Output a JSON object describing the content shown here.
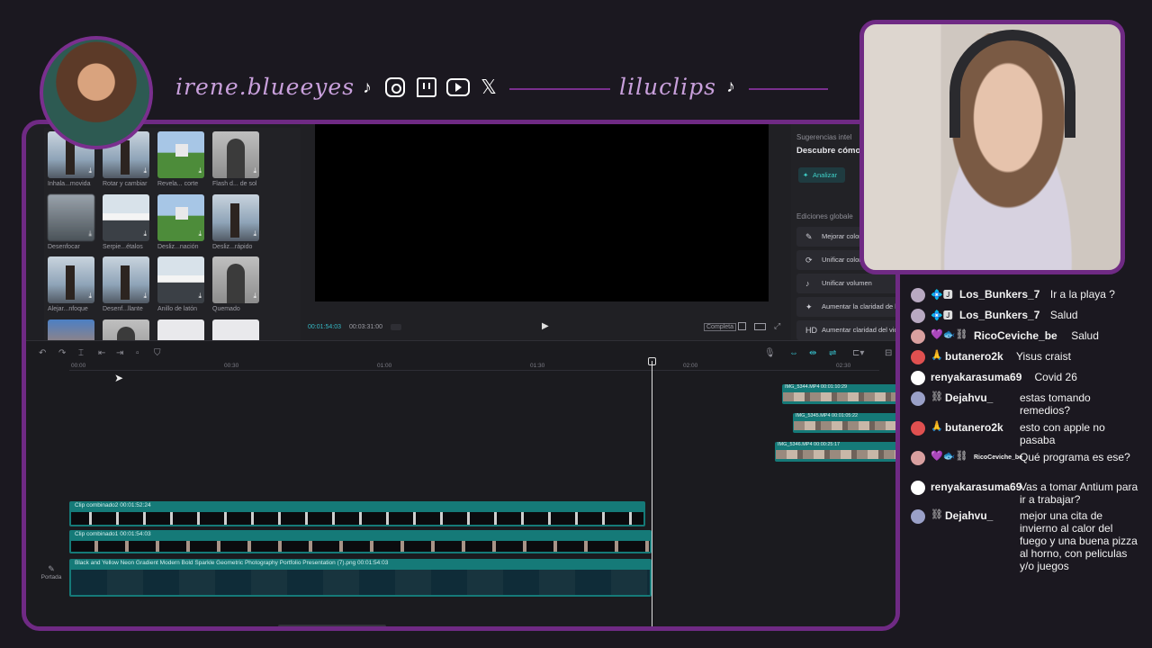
{
  "header": {
    "handle": "irene.blueeyes",
    "second_handle": "liluclips",
    "social_icons": [
      "tiktok-icon",
      "instagram-icon",
      "twitch-icon",
      "youtube-icon",
      "x-icon"
    ],
    "accent_color": "#6f2a84"
  },
  "effects": {
    "items": [
      {
        "label": "Inhala...movida",
        "thumb": "tower"
      },
      {
        "label": "Rotar y cambiar",
        "thumb": "tower"
      },
      {
        "label": "Revela... corte",
        "thumb": "field"
      },
      {
        "label": "Flash d... de sol",
        "thumb": "person"
      },
      {
        "label": "Desenfocar",
        "thumb": "blur"
      },
      {
        "label": "Serpie...étalos",
        "thumb": "mount"
      },
      {
        "label": "Desliz...nación",
        "thumb": "field"
      },
      {
        "label": "Desliz...rápido",
        "thumb": "tower"
      },
      {
        "label": "Alejar...nfoque",
        "thumb": "tower"
      },
      {
        "label": "Desenf...llante",
        "thumb": "tower"
      },
      {
        "label": "Anillo de latón",
        "thumb": "mount"
      },
      {
        "label": "Quemado",
        "thumb": "person"
      },
      {
        "label": "",
        "thumb": "orange"
      },
      {
        "label": "",
        "thumb": "person"
      },
      {
        "label": "",
        "thumb": "white"
      },
      {
        "label": "",
        "thumb": "white"
      }
    ]
  },
  "preview": {
    "current_time": "00:01:54:03",
    "total_time": "00:03:31:00",
    "complete_label": "Completa"
  },
  "side_panel": {
    "heading": "Sugerencias intel",
    "subheading": "Descubre cómo",
    "analyze_label": "Analizar",
    "global_heading": "Ediciones globale",
    "buttons": [
      {
        "icon": "palette-icon",
        "glyph": "✎",
        "label": "Mejorar color"
      },
      {
        "icon": "sync-icon",
        "glyph": "⟳",
        "label": "Unificar colore"
      },
      {
        "icon": "volume-icon",
        "glyph": "♪",
        "label": "Unificar volumen"
      },
      {
        "icon": "sparkle-icon",
        "glyph": "✦",
        "label": "Aumentar la claridad de la"
      },
      {
        "icon": "hd-icon",
        "glyph": "HD",
        "label": "Aumentar claridad del vide"
      }
    ]
  },
  "timeline": {
    "ruler": [
      "00:00",
      "00:30",
      "01:00",
      "01:30",
      "02:00",
      "02:30"
    ],
    "tracks": [
      {
        "label": "Clip combinado2  00:01:52:24"
      },
      {
        "label": "Clip combinado1  00:01:54:03"
      },
      {
        "label": "Black and Yellow Neon Gradient Modern Bold Sparkle Geometric Photography Portfolio Presentation (7).png  00:01:54:03"
      }
    ],
    "right_clips": [
      {
        "label": "IMG_5344.MP4  00:01:10:29"
      },
      {
        "label": "IMG_5345.MP4  00:01:05:22"
      },
      {
        "label": "IMG_5346.MP4  00:00:25:17"
      }
    ],
    "cover_label": "Portada"
  },
  "chat": {
    "messages": [
      {
        "user": "Los_Bunkers_7",
        "text": "Ir a la playa ?",
        "badges": "💠🅹",
        "color": "#b9a9c2"
      },
      {
        "user": "Los_Bunkers_7",
        "text": "Salud",
        "badges": "💠🅹",
        "color": "#b9a9c2"
      },
      {
        "user": "RicoCeviche_be",
        "text": "Salud",
        "badges": "💜🐟⛓",
        "color": "#d9a0a0"
      },
      {
        "user": "butanero2k",
        "text": "Yisus craist",
        "badges": "🙏",
        "color": "#e05050"
      },
      {
        "user": "renyakarasuma69",
        "text": "Covid 26",
        "badges": "",
        "color": "#ffffff"
      },
      {
        "user": "Dejahvu_",
        "text": "estas tomando remedios?",
        "badges": "⛓",
        "color": "#9aa0c8"
      },
      {
        "user": "butanero2k",
        "text": "esto con apple no pasaba",
        "badges": "🙏",
        "color": "#e05050"
      },
      {
        "user": "RicoCeviche_be",
        "text": "Qué programa es ese?",
        "badges": "💜🐟⛓",
        "color": "#d9a0a0"
      },
      {
        "user": "renyakarasuma69",
        "text": "Vas a tomar Antium para ir a trabajar?",
        "badges": "",
        "color": "#ffffff"
      },
      {
        "user": "Dejahvu_",
        "text": "mejor una cita de invierno al calor del fuego y una buena pizza al horno, con peliculas y/o juegos",
        "badges": "⛓",
        "color": "#9aa0c8"
      }
    ]
  }
}
